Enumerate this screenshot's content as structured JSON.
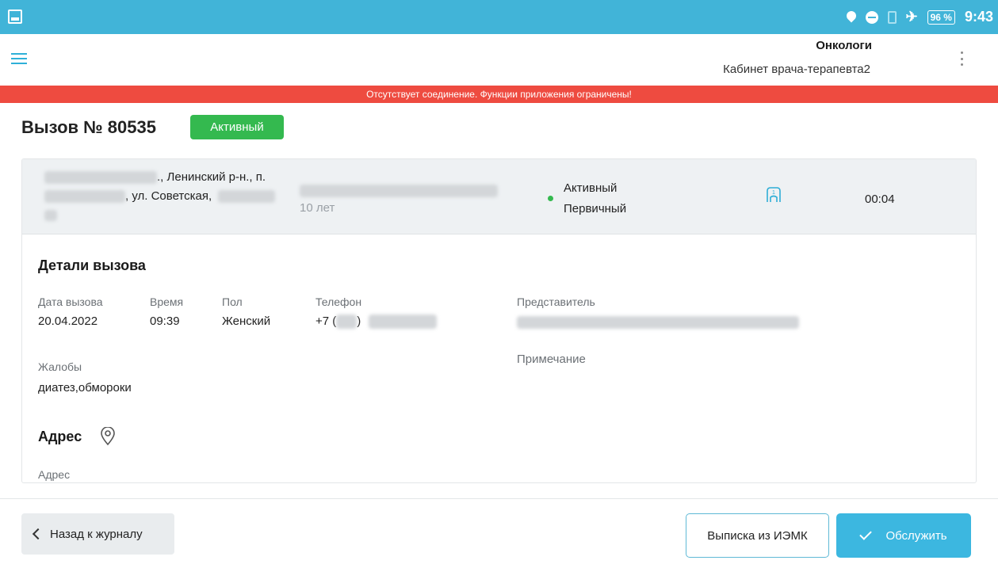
{
  "status_bar": {
    "battery": "96 %",
    "time": "9:43",
    "icons": [
      "gallery-icon",
      "location-pin-icon",
      "do-not-disturb-icon",
      "sim-icon",
      "airplane-icon",
      "battery-icon"
    ]
  },
  "app_bar": {
    "title": "Онкологи",
    "subtitle": "Кабинет врача-терапевта2",
    "icons": [
      "menu-icon",
      "more-vert-icon"
    ]
  },
  "banner": {
    "text": "Отсутствует соединение. Функции приложения ограничены!",
    "color": "#ee4b40"
  },
  "call": {
    "title": "Вызов № 80535",
    "status": "Активный",
    "status_color": "#34b94f"
  },
  "summary": {
    "address_line1": "., Ленинский р-н., п.",
    "address_line2": ", ул. Советская,",
    "patient_age": "10 лет",
    "state": "Активный",
    "type": "Первичный",
    "timer": "00:04",
    "icons": [
      "nurse-icon"
    ]
  },
  "details": {
    "title": "Детали вызова",
    "date_label": "Дата вызова",
    "date_value": "20.04.2022",
    "time_label": "Время",
    "time_value": "09:39",
    "sex_label": "Пол",
    "sex_value": "Женский",
    "phone_label": "Телефон",
    "phone_prefix": "+7 (",
    "phone_paren": ")",
    "representative_label": "Представитель",
    "complaints_label": "Жалобы",
    "complaints_value": "диатез,обмороки",
    "note_label": "Примечание"
  },
  "address_section": {
    "title": "Адрес",
    "address_label": "Адрес",
    "icons": [
      "map-pin-icon"
    ]
  },
  "footer": {
    "back_label": "Назад к журналу",
    "extract_label": "Выписка из ИЭМК",
    "serve_label": "Обслужить",
    "accent": "#3cb7e0"
  }
}
